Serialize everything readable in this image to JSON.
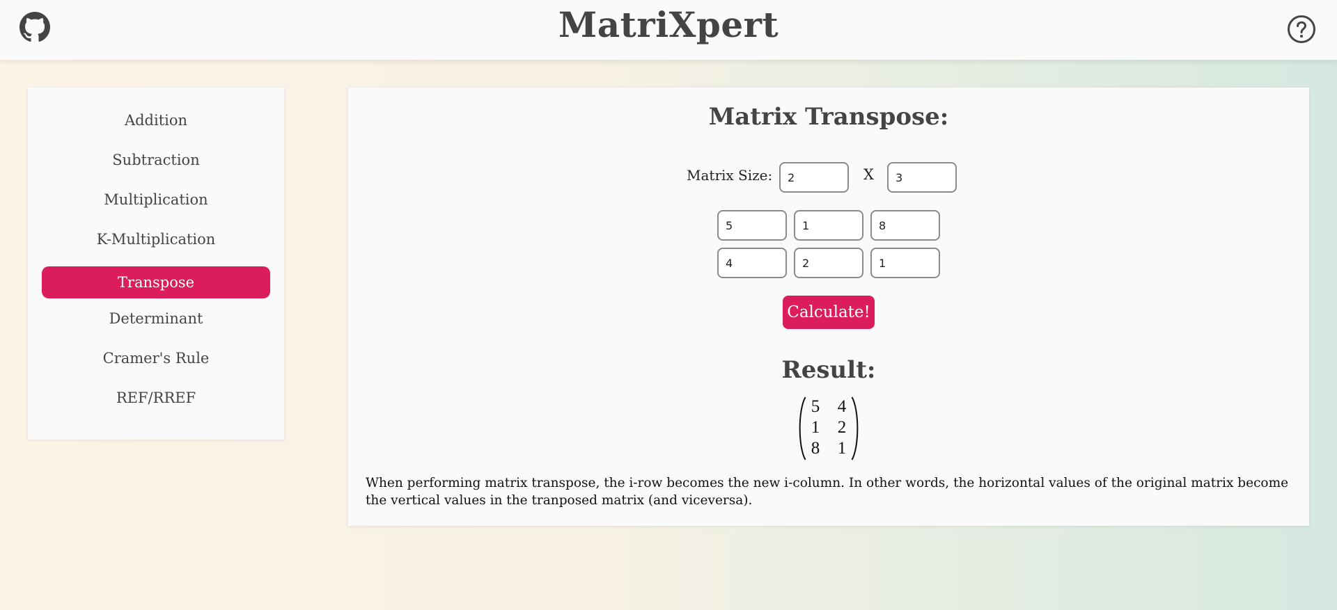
{
  "header": {
    "title": "MatriXpert",
    "left_icon": "github-icon",
    "right_icon": "help-icon"
  },
  "sidebar": {
    "items": [
      {
        "label": "Addition",
        "active": false
      },
      {
        "label": "Subtraction",
        "active": false
      },
      {
        "label": "Multiplication",
        "active": false
      },
      {
        "label": "K-Multiplication",
        "active": false
      },
      {
        "label": "Transpose",
        "active": true
      },
      {
        "label": "Determinant",
        "active": false
      },
      {
        "label": "Cramer's Rule",
        "active": false
      },
      {
        "label": "REF/RREF",
        "active": false
      }
    ]
  },
  "main": {
    "title": "Matrix Transpose:",
    "size_label": "Matrix Size:",
    "size_separator": "X",
    "rows_value": "2",
    "cols_value": "3",
    "matrix": [
      [
        "5",
        "1",
        "8"
      ],
      [
        "4",
        "2",
        "1"
      ]
    ],
    "calculate_label": "Calculate!",
    "result_title": "Result:",
    "result": [
      [
        "5",
        "4"
      ],
      [
        "1",
        "2"
      ],
      [
        "8",
        "1"
      ]
    ],
    "description": "When performing matrix transpose, the i-row becomes the new i-column. In other words, the horizontal values of the original matrix become the vertical values in the tranposed matrix (and viceversa)."
  },
  "colors": {
    "accent": "#dc1d5c",
    "text": "#444444",
    "panel": "#fafafa"
  }
}
